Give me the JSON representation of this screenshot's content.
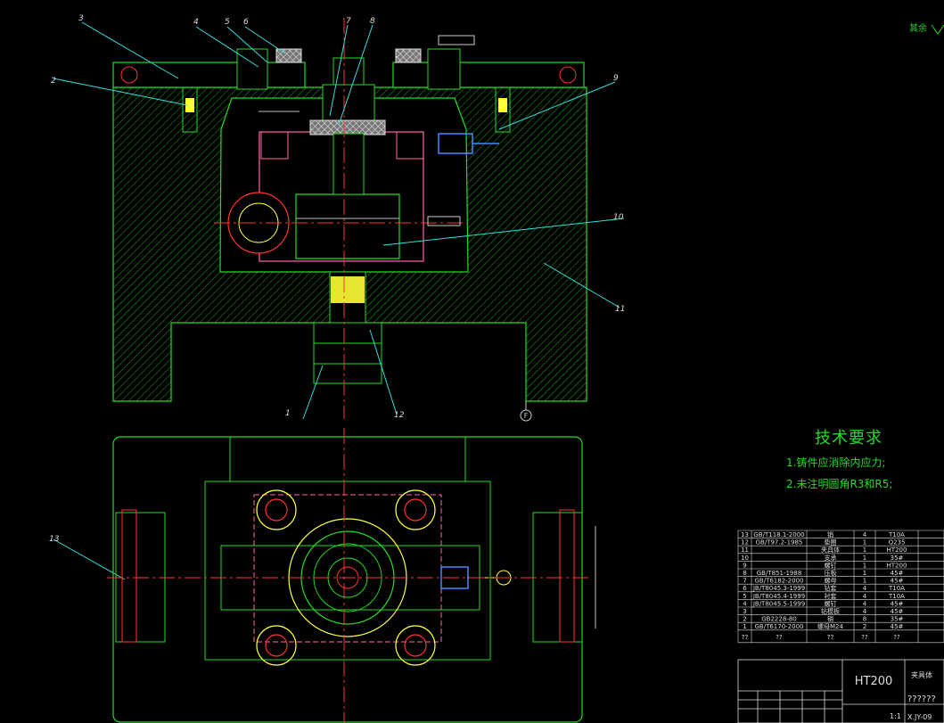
{
  "surface_note": "其余",
  "balloons": [
    "1",
    "2",
    "3",
    "4",
    "5",
    "6",
    "7",
    "8",
    "9",
    "10",
    "11",
    "12",
    "13"
  ],
  "datum": "F",
  "tech": {
    "title": "技术要求",
    "items": [
      "1.铸件应消除内应力;",
      "2.未注明圆角R3和R5;"
    ]
  },
  "bom": [
    {
      "no": "13",
      "std": "GB/T118.1-2000",
      "name": "销",
      "qty": "4",
      "mat": "T10A"
    },
    {
      "no": "12",
      "std": "GB/T97.2-1985",
      "name": "垫圈",
      "qty": "1",
      "mat": "Q235"
    },
    {
      "no": "11",
      "std": "",
      "name": "夹具体",
      "qty": "1",
      "mat": "HT200"
    },
    {
      "no": "10",
      "std": "",
      "name": "支承",
      "qty": "1",
      "mat": "35#"
    },
    {
      "no": "9",
      "std": "",
      "name": "螺钉",
      "qty": "1",
      "mat": "HT200"
    },
    {
      "no": "8",
      "std": "GB/T851-1988",
      "name": "压板",
      "qty": "1",
      "mat": "45#"
    },
    {
      "no": "7",
      "std": "GB/T6182-2000",
      "name": "螺母",
      "qty": "1",
      "mat": "45#"
    },
    {
      "no": "6",
      "std": "JB/T8045.3-1999",
      "name": "钻套",
      "qty": "4",
      "mat": "T10A"
    },
    {
      "no": "5",
      "std": "JB/T8045.4-1999",
      "name": "衬套",
      "qty": "4",
      "mat": "T10A"
    },
    {
      "no": "4",
      "std": "JB/T8045.5-1999",
      "name": "螺钉",
      "qty": "4",
      "mat": "45#"
    },
    {
      "no": "3",
      "std": "",
      "name": "钻模板",
      "qty": "4",
      "mat": "45#"
    },
    {
      "no": "2",
      "std": "GB2228-80",
      "name": "销",
      "qty": "8",
      "mat": "35#"
    },
    {
      "no": "1",
      "std": "GB/T6170-2000",
      "name": "螺母M24",
      "qty": "2",
      "mat": "45#"
    }
  ],
  "bom_header": {
    "no": "??",
    "std": "??",
    "name": "??",
    "qty": "??",
    "mat": "??"
  },
  "title_block": {
    "material": "HT200",
    "name": "夹具体",
    "unknown": "??????",
    "scale": "1:1",
    "drawing_no": "X.JY-09"
  }
}
